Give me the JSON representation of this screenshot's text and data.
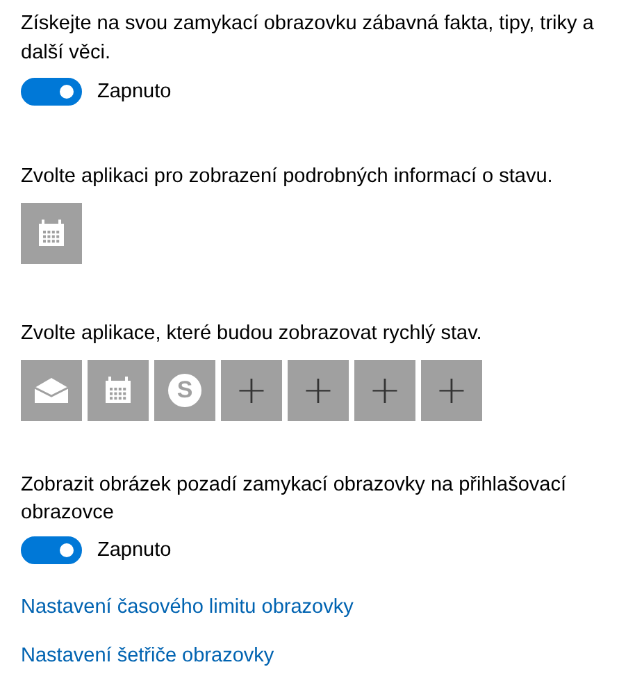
{
  "tips": {
    "label": "Získejte na svou zamykací obrazovku zábavná fakta, tipy, triky a další věci.",
    "toggle": {
      "on": true,
      "text": "Zapnuto"
    }
  },
  "detailed_status": {
    "label": "Zvolte aplikaci pro zobrazení podrobných informací o stavu.",
    "apps": [
      {
        "kind": "calendar"
      }
    ]
  },
  "quick_status": {
    "label": "Zvolte aplikace, které budou zobrazovat rychlý stav.",
    "apps": [
      {
        "kind": "mail"
      },
      {
        "kind": "calendar"
      },
      {
        "kind": "chat",
        "glyph": "S"
      },
      {
        "kind": "add",
        "glyph": "+"
      },
      {
        "kind": "add",
        "glyph": "+"
      },
      {
        "kind": "add",
        "glyph": "+"
      },
      {
        "kind": "add",
        "glyph": "+"
      }
    ]
  },
  "signin_background": {
    "label": "Zobrazit obrázek pozadí zamykací obrazovky na přihlašovací obrazovce",
    "toggle": {
      "on": true,
      "text": "Zapnuto"
    }
  },
  "links": [
    "Nastavení časového limitu obrazovky",
    "Nastavení šetřiče obrazovky"
  ]
}
